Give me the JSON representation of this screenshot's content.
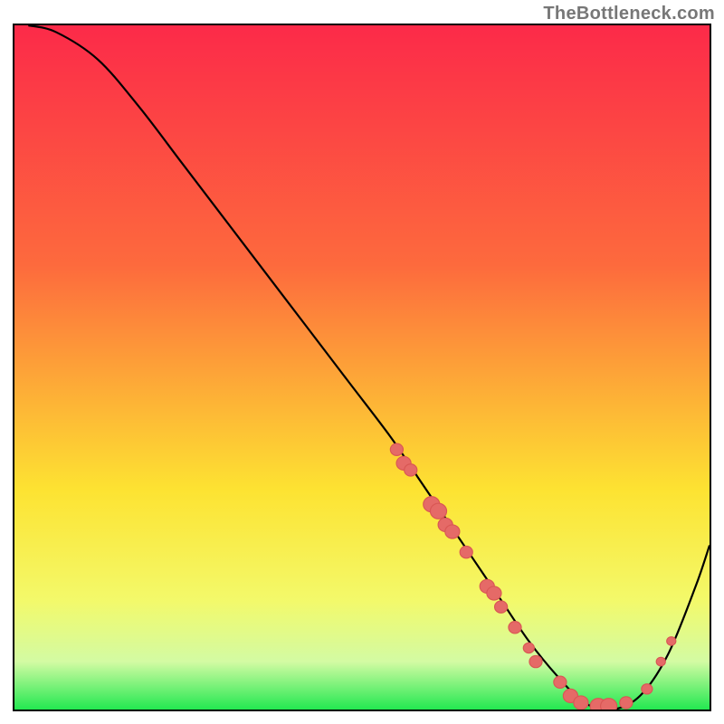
{
  "attribution": "TheBottleneck.com",
  "colors": {
    "gradient_top": "#fc2a49",
    "gradient_mid1": "#fd6a3d",
    "gradient_mid2": "#fde332",
    "gradient_mid3": "#f3f96a",
    "gradient_mid4": "#d3fba3",
    "gradient_bottom": "#23e851",
    "curve": "#000000",
    "marker_fill": "#e56a67",
    "marker_stroke": "#d95754"
  },
  "chart_data": {
    "type": "line",
    "title": "",
    "xlabel": "",
    "ylabel": "",
    "xlim": [
      0,
      100
    ],
    "ylim": [
      0,
      100
    ],
    "grid": false,
    "legend": false,
    "series": [
      {
        "name": "curve",
        "x": [
          2,
          6,
          12,
          18,
          24,
          30,
          36,
          42,
          48,
          54,
          58,
          62,
          66,
          70,
          74,
          78,
          82,
          86,
          90,
          94,
          98,
          100
        ],
        "y": [
          100,
          99,
          95,
          88,
          80,
          72,
          64,
          56,
          48,
          40,
          34,
          28,
          22,
          16,
          10,
          5,
          1,
          0,
          2,
          8,
          18,
          24
        ]
      }
    ],
    "markers": [
      {
        "x": 55,
        "y": 38,
        "size": 7
      },
      {
        "x": 56,
        "y": 36,
        "size": 8
      },
      {
        "x": 57,
        "y": 35,
        "size": 7
      },
      {
        "x": 60,
        "y": 30,
        "size": 9
      },
      {
        "x": 61,
        "y": 29,
        "size": 9
      },
      {
        "x": 62,
        "y": 27,
        "size": 8
      },
      {
        "x": 63,
        "y": 26,
        "size": 8
      },
      {
        "x": 65,
        "y": 23,
        "size": 7
      },
      {
        "x": 68,
        "y": 18,
        "size": 8
      },
      {
        "x": 69,
        "y": 17,
        "size": 8
      },
      {
        "x": 70,
        "y": 15,
        "size": 7
      },
      {
        "x": 72,
        "y": 12,
        "size": 7
      },
      {
        "x": 74,
        "y": 9,
        "size": 6
      },
      {
        "x": 75,
        "y": 7,
        "size": 7
      },
      {
        "x": 78.5,
        "y": 4,
        "size": 7
      },
      {
        "x": 80,
        "y": 2,
        "size": 8
      },
      {
        "x": 81.5,
        "y": 1,
        "size": 8
      },
      {
        "x": 84,
        "y": 0.5,
        "size": 9
      },
      {
        "x": 85.5,
        "y": 0.5,
        "size": 9
      },
      {
        "x": 88,
        "y": 1,
        "size": 7
      },
      {
        "x": 91,
        "y": 3,
        "size": 6
      },
      {
        "x": 93,
        "y": 7,
        "size": 5
      },
      {
        "x": 94.5,
        "y": 10,
        "size": 5
      }
    ]
  }
}
